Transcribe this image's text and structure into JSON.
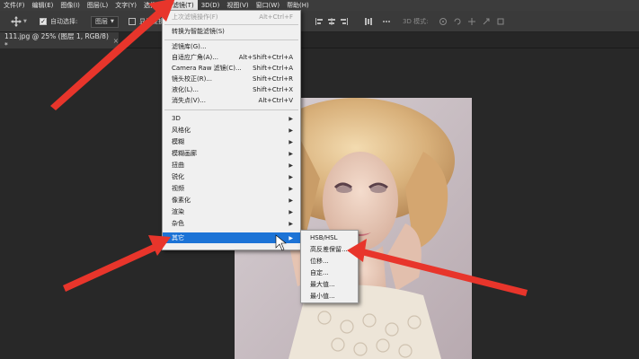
{
  "menubar": {
    "items": [
      {
        "label": "文件(F)"
      },
      {
        "label": "编辑(E)"
      },
      {
        "label": "图像(I)"
      },
      {
        "label": "图层(L)"
      },
      {
        "label": "文字(Y)"
      },
      {
        "label": "选择(S)"
      },
      {
        "label": "滤镜(T)",
        "active": true
      },
      {
        "label": "3D(D)"
      },
      {
        "label": "视图(V)"
      },
      {
        "label": "窗口(W)"
      },
      {
        "label": "帮助(H)"
      }
    ]
  },
  "options": {
    "auto_select_label": "自动选择:",
    "layer_dropdown": "图层",
    "transform_label": "显示变换控件",
    "mode_3d": "3D 模式:"
  },
  "document_tab": {
    "title": "111.jpg @ 25% (图层 1, RGB/8) *",
    "close": "×"
  },
  "filter_menu": {
    "items": [
      {
        "label": "上次滤镜操作(F)",
        "shortcut": "Alt+Ctrl+F",
        "disabled": true
      },
      {
        "separator": true
      },
      {
        "label": "转换为智能滤镜(S)",
        "shortcut": ""
      },
      {
        "separator": true
      },
      {
        "label": "滤镜库(G)...",
        "shortcut": ""
      },
      {
        "label": "自适应广角(A)...",
        "shortcut": "Alt+Shift+Ctrl+A"
      },
      {
        "label": "Camera Raw 滤镜(C)...",
        "shortcut": "Shift+Ctrl+A"
      },
      {
        "label": "镜头校正(R)...",
        "shortcut": "Shift+Ctrl+R"
      },
      {
        "label": "液化(L)...",
        "shortcut": "Shift+Ctrl+X"
      },
      {
        "label": "消失点(V)...",
        "shortcut": "Alt+Ctrl+V"
      },
      {
        "separator": true
      },
      {
        "label": "3D",
        "submenu": true
      },
      {
        "label": "风格化",
        "submenu": true
      },
      {
        "label": "模糊",
        "submenu": true
      },
      {
        "label": "模糊画廊",
        "submenu": true
      },
      {
        "label": "扭曲",
        "submenu": true
      },
      {
        "label": "锐化",
        "submenu": true
      },
      {
        "label": "视频",
        "submenu": true
      },
      {
        "label": "像素化",
        "submenu": true
      },
      {
        "label": "渲染",
        "submenu": true
      },
      {
        "label": "杂色",
        "submenu": true
      },
      {
        "label": "其它",
        "submenu": true,
        "highlighted": true
      }
    ]
  },
  "other_submenu": {
    "items": [
      {
        "label": "HSB/HSL"
      },
      {
        "label": "高反差保留..."
      },
      {
        "label": "位移..."
      },
      {
        "label": "自定..."
      },
      {
        "label": "最大值..."
      },
      {
        "label": "最小值..."
      }
    ]
  },
  "annotation_color": "#e8352b"
}
